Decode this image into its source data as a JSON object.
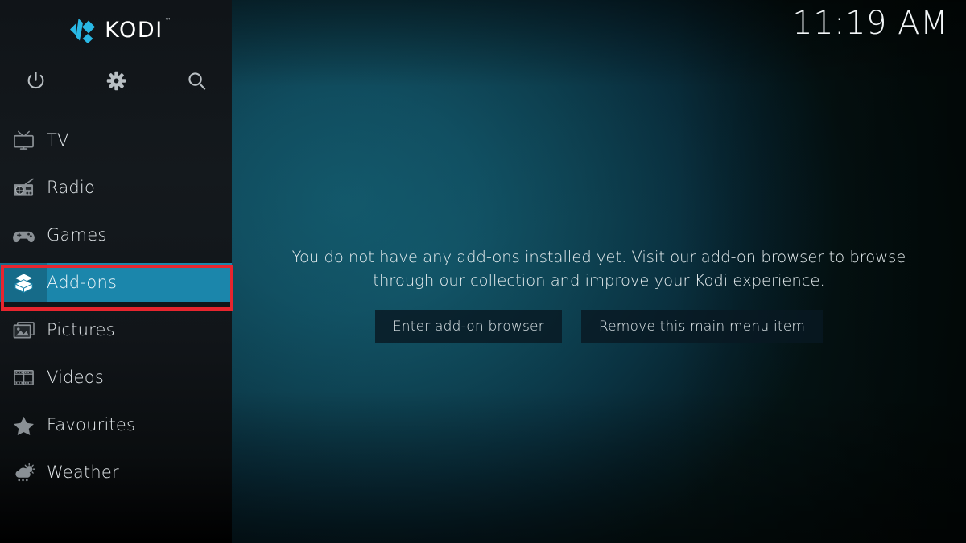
{
  "app": {
    "name": "Kodi",
    "logo_text": "KODI",
    "logo_trademark": "™",
    "accent_blue": "#29b8e5",
    "selection_teal": "#1b86ab",
    "annotation_red": "#e8252e"
  },
  "header": {
    "clock": "11:19 AM"
  },
  "quick_actions": [
    {
      "name": "power-button",
      "icon": "power-icon",
      "label": "Power"
    },
    {
      "name": "settings-button",
      "icon": "gear-icon",
      "label": "Settings"
    },
    {
      "name": "search-button",
      "icon": "search-icon",
      "label": "Search"
    }
  ],
  "sidebar": {
    "items": [
      {
        "label": "TV",
        "icon": "tv-icon",
        "selected": false
      },
      {
        "label": "Radio",
        "icon": "radio-icon",
        "selected": false
      },
      {
        "label": "Games",
        "icon": "gamepad-icon",
        "selected": false
      },
      {
        "label": "Add-ons",
        "icon": "addons-box-icon",
        "selected": true
      },
      {
        "label": "Pictures",
        "icon": "pictures-icon",
        "selected": false
      },
      {
        "label": "Videos",
        "icon": "film-strip-icon",
        "selected": false
      },
      {
        "label": "Favourites",
        "icon": "star-icon",
        "selected": false
      },
      {
        "label": "Weather",
        "icon": "weather-icon",
        "selected": false
      }
    ]
  },
  "main": {
    "empty_message": "You do not have any add-ons installed yet. Visit our add-on browser to browse through our collection and improve your Kodi experience.",
    "buttons": [
      {
        "label": "Enter add-on browser"
      },
      {
        "label": "Remove this main menu item"
      }
    ]
  }
}
